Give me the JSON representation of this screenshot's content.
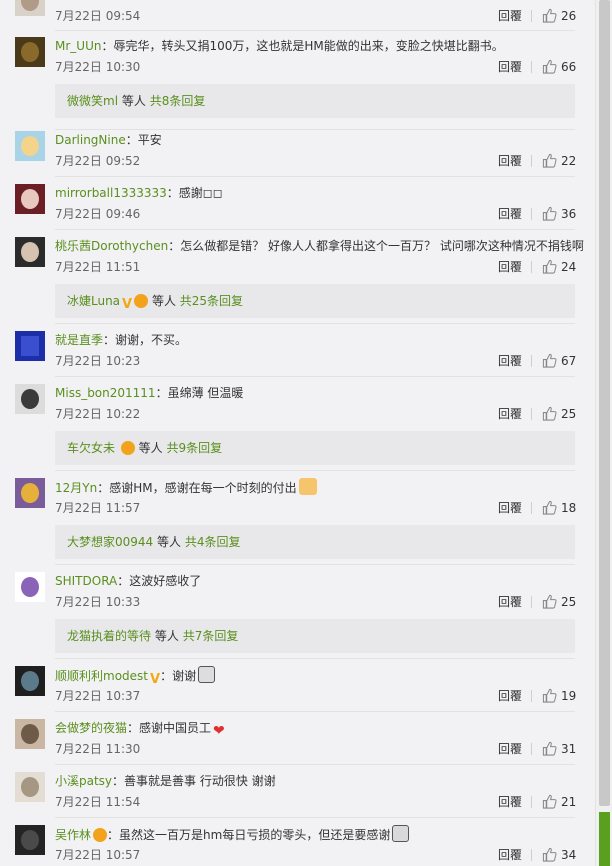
{
  "ui": {
    "reply_label": "回覆",
    "reply_more_middle": "等人",
    "colon": "：",
    "colors": {
      "link_green": "#5a8f1e",
      "panel_bg": "#f2f2f5",
      "reply_box_bg": "#e8e8eb",
      "heart": "#e03131"
    },
    "icons": {
      "like": "thumbs-up-icon",
      "vip_badge": "vip-badge-icon",
      "member_badge": "member-crown-icon",
      "heart": "heart-emoji",
      "clap": "clap-emoji"
    }
  },
  "comments": [
    {
      "user": "",
      "text": "",
      "time": "7月22日 09:54",
      "likes": "26"
    },
    {
      "user": "Mr_UUn",
      "text": "辱完华，转头又捐100万，这也就是HM能做的出来，变脸之快堪比翻书。",
      "time": "7月22日 10:30",
      "likes": "66",
      "replies": {
        "user": "微微笑ml",
        "more": "共8条回复"
      }
    },
    {
      "user": "DarlingNine",
      "text": "平安",
      "time": "7月22日 09:52",
      "likes": "22"
    },
    {
      "user": "mirrorball1333333",
      "text": "感謝◻◻",
      "time": "7月22日 09:46",
      "likes": "36"
    },
    {
      "user": "桃乐茜Dorothychen",
      "text": "怎么做都是错？ 好像人人都拿得出这个一百万？ 试问哪次这种情况不捐钱啊",
      "time": "7月22日 11:51",
      "likes": "24",
      "replies": {
        "user": "冰婕Luna",
        "more": "共25条回复"
      }
    },
    {
      "user": "就是直季",
      "text": "谢谢，不买。",
      "time": "7月22日 10:23",
      "likes": "67"
    },
    {
      "user": "Miss_bon201111",
      "text": "虽绵薄 但温暖",
      "time": "7月22日 10:22",
      "likes": "25",
      "replies": {
        "user": "车欠女未",
        "more": "共9条回复"
      }
    },
    {
      "user": "12月Yn",
      "text": "感谢HM，感谢在每一个时刻的付出",
      "time": "7月22日 11:57",
      "likes": "18",
      "replies": {
        "user": "大梦想家00944",
        "more": "共4条回复"
      }
    },
    {
      "user": "SHITDORA",
      "text": "这波好感收了",
      "time": "7月22日 10:33",
      "likes": "25",
      "replies": {
        "user": "龙猫执着的等待",
        "more": "共7条回复"
      }
    },
    {
      "user": "顺顺利利modest",
      "text": "谢谢",
      "time": "7月22日 10:37",
      "likes": "19"
    },
    {
      "user": "会做梦的夜猫",
      "text": "感谢中国员工",
      "time": "7月22日 11:30",
      "likes": "31"
    },
    {
      "user": "小溪patsy",
      "text": "善事就是善事 行动很快 谢谢",
      "time": "7月22日 11:54",
      "likes": "21"
    },
    {
      "user": "吴作林",
      "text": "虽然这一百万是hm每日亏损的零头，但还是要感谢",
      "time": "7月22日 10:57",
      "likes": "34"
    }
  ]
}
